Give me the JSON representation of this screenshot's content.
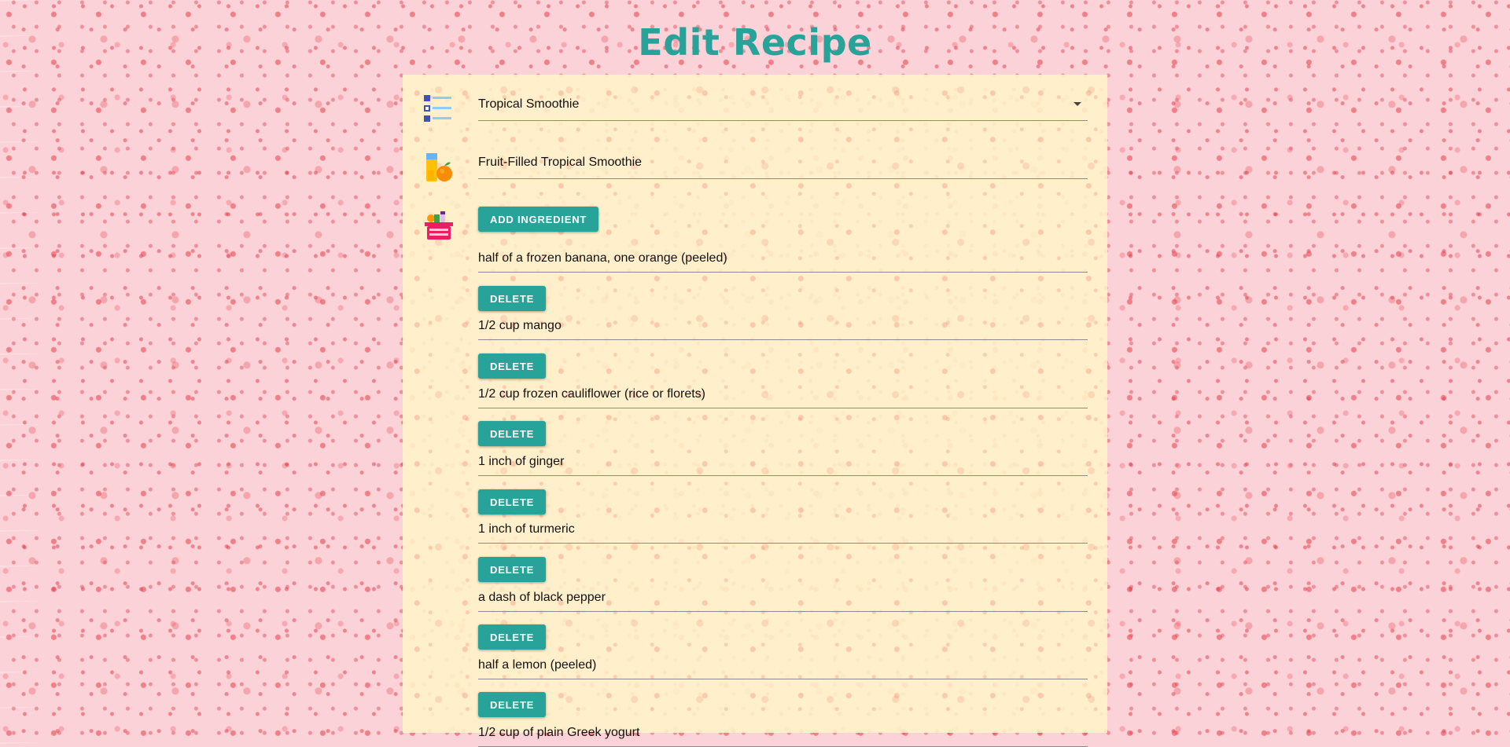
{
  "page": {
    "title": "Edit Recipe"
  },
  "form": {
    "category": {
      "value": "Tropical Smoothie",
      "icon": "checklist-icon"
    },
    "name": {
      "value": "Fruit-Filled Tropical Smoothie",
      "icon": "smoothie-icon"
    },
    "ingredients": {
      "icon": "grocery-basket-icon",
      "add_label": "ADD INGREDIENT",
      "delete_label": "DELETE",
      "items": [
        "half of a frozen banana, one orange (peeled)",
        "1/2 cup mango",
        "1/2 cup frozen cauliflower (rice or florets)",
        "1 inch of ginger",
        "1 inch of turmeric",
        "a dash of black pepper",
        "half a lemon (peeled)",
        "1/2 cup of plain Greek yogurt"
      ]
    }
  },
  "colors": {
    "accent": "#27a39a",
    "panel": "#fff4c8",
    "background": "#fbd2d8"
  }
}
